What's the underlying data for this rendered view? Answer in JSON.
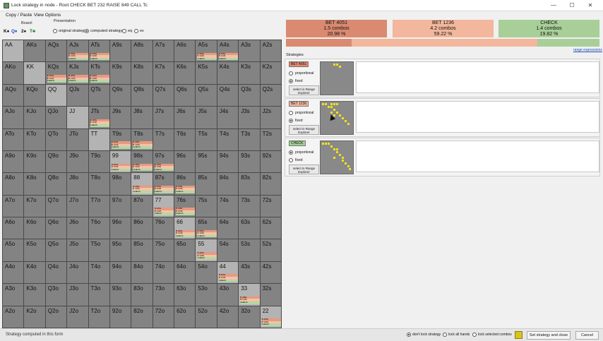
{
  "window": {
    "title": "Lock strategy in node - Root CHECK BET 232 RAISE 849 CALL Tc",
    "controls": [
      "—",
      "☐",
      "✕"
    ]
  },
  "menu": {
    "copy_paste": "Copy / Paste",
    "view_options": "View Options"
  },
  "board": {
    "label": "Board:",
    "cards": [
      {
        "text": "K♠",
        "color": "#111111"
      },
      {
        "text": "Q♦",
        "color": "#1f4fbf"
      },
      {
        "text": "2♠",
        "color": "#111111"
      },
      {
        "text": "T♣",
        "color": "#1e7a2e"
      }
    ]
  },
  "presentation": {
    "label": "Presentation",
    "options": [
      {
        "label": "original strategy",
        "selected": false
      },
      {
        "label": "computed strategy",
        "selected": true
      },
      {
        "label": "eq",
        "selected": false
      },
      {
        "label": "ev",
        "selected": false
      }
    ]
  },
  "grid": {
    "ranks": [
      "A",
      "K",
      "Q",
      "J",
      "T",
      "9",
      "8",
      "7",
      "6",
      "5",
      "4",
      "3",
      "2"
    ],
    "legend": {
      "b1": "B 4051",
      "b2": "B 1236",
      "ck": "CHECK"
    },
    "detail_hands": [
      "AJs",
      "ATs",
      "A5s",
      "A4s",
      "KQs",
      "KJs",
      "KTs",
      "JTs",
      "T9s",
      "T8s",
      "99",
      "98s",
      "97s",
      "88",
      "87s",
      "86s",
      "77",
      "76s",
      "66",
      "65s",
      "55",
      "44",
      "33",
      "22"
    ]
  },
  "actions": [
    {
      "label": "BET 4051",
      "combos": "1.5 combos",
      "pct": "20.98 %",
      "share": 0.2098,
      "color": "#d98a70"
    },
    {
      "label": "BET 1236",
      "combos": "4.2 combos",
      "pct": "59.22 %",
      "share": 0.5922,
      "color": "#f2b79c"
    },
    {
      "label": "CHECK",
      "combos": "1.4 combos",
      "pct": "19.82 %",
      "share": 0.1982,
      "color": "#a8cf98"
    }
  ],
  "strategies": {
    "label": "Strategies",
    "range_link": "range expressions",
    "panels": [
      {
        "tag": "BET 4051",
        "tag_color": "#e28a6e",
        "proportional": "proportional",
        "fixed": "fixed",
        "selected": "fixed",
        "select_btn": "select in Range Explorer"
      },
      {
        "tag": "BET 1236",
        "tag_color": "#f4b79d",
        "proportional": "proportional",
        "fixed": "fixed",
        "selected": "fixed",
        "select_btn": "select in Range Explorer"
      },
      {
        "tag": "CHECK",
        "tag_color": "#9fd48e",
        "proportional": "proportional",
        "fixed": "fixed",
        "selected": "proportional",
        "select_btn": "select in Range Explorer"
      }
    ]
  },
  "footer": {
    "status": "Strategy computed in this form",
    "options": [
      {
        "label": "don't lock strategy",
        "selected": true
      },
      {
        "label": "lock all hands",
        "selected": false
      },
      {
        "label": "lock selected combos",
        "selected": false
      }
    ],
    "set_btn": "Set strategy and close",
    "cancel_btn": "Cancel"
  }
}
